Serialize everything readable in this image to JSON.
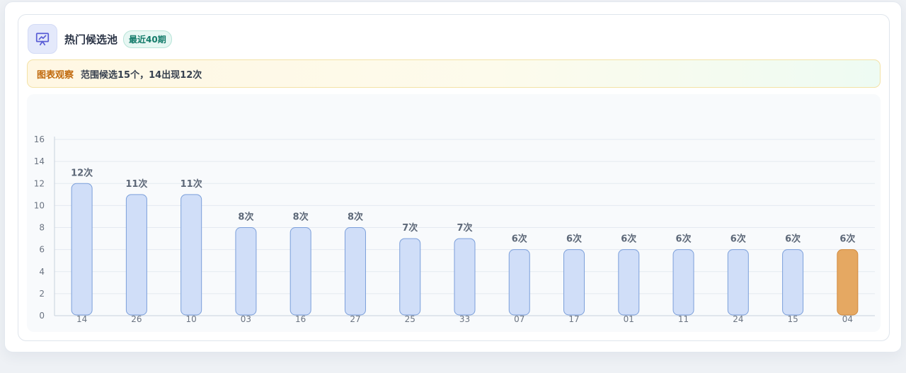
{
  "header": {
    "title": "热门候选池",
    "badge": "最近40期",
    "icon": "presentation-chart-icon"
  },
  "insight": {
    "label": "图表观察",
    "text": "范围候选15个，14出现12次"
  },
  "colors": {
    "bar_fill": "#d0def8",
    "bar_stroke": "#7b9fda",
    "highlight_fill": "#e5a862",
    "highlight_stroke": "#d18a3e",
    "accent": "#5b5fd6"
  },
  "chart_data": {
    "type": "bar",
    "categories": [
      "14",
      "26",
      "10",
      "03",
      "16",
      "27",
      "25",
      "33",
      "07",
      "17",
      "01",
      "11",
      "24",
      "15",
      "04"
    ],
    "values": [
      12,
      11,
      11,
      8,
      8,
      8,
      7,
      7,
      6,
      6,
      6,
      6,
      6,
      6,
      6
    ],
    "value_labels": [
      "12次",
      "11次",
      "11次",
      "8次",
      "8次",
      "8次",
      "7次",
      "7次",
      "6次",
      "6次",
      "6次",
      "6次",
      "6次",
      "6次",
      "6次"
    ],
    "highlight_category": "04",
    "ylim": [
      0,
      16
    ],
    "yticks": [
      "0",
      "2",
      "4",
      "6",
      "8",
      "10",
      "12",
      "14",
      "16"
    ],
    "grid": true
  }
}
